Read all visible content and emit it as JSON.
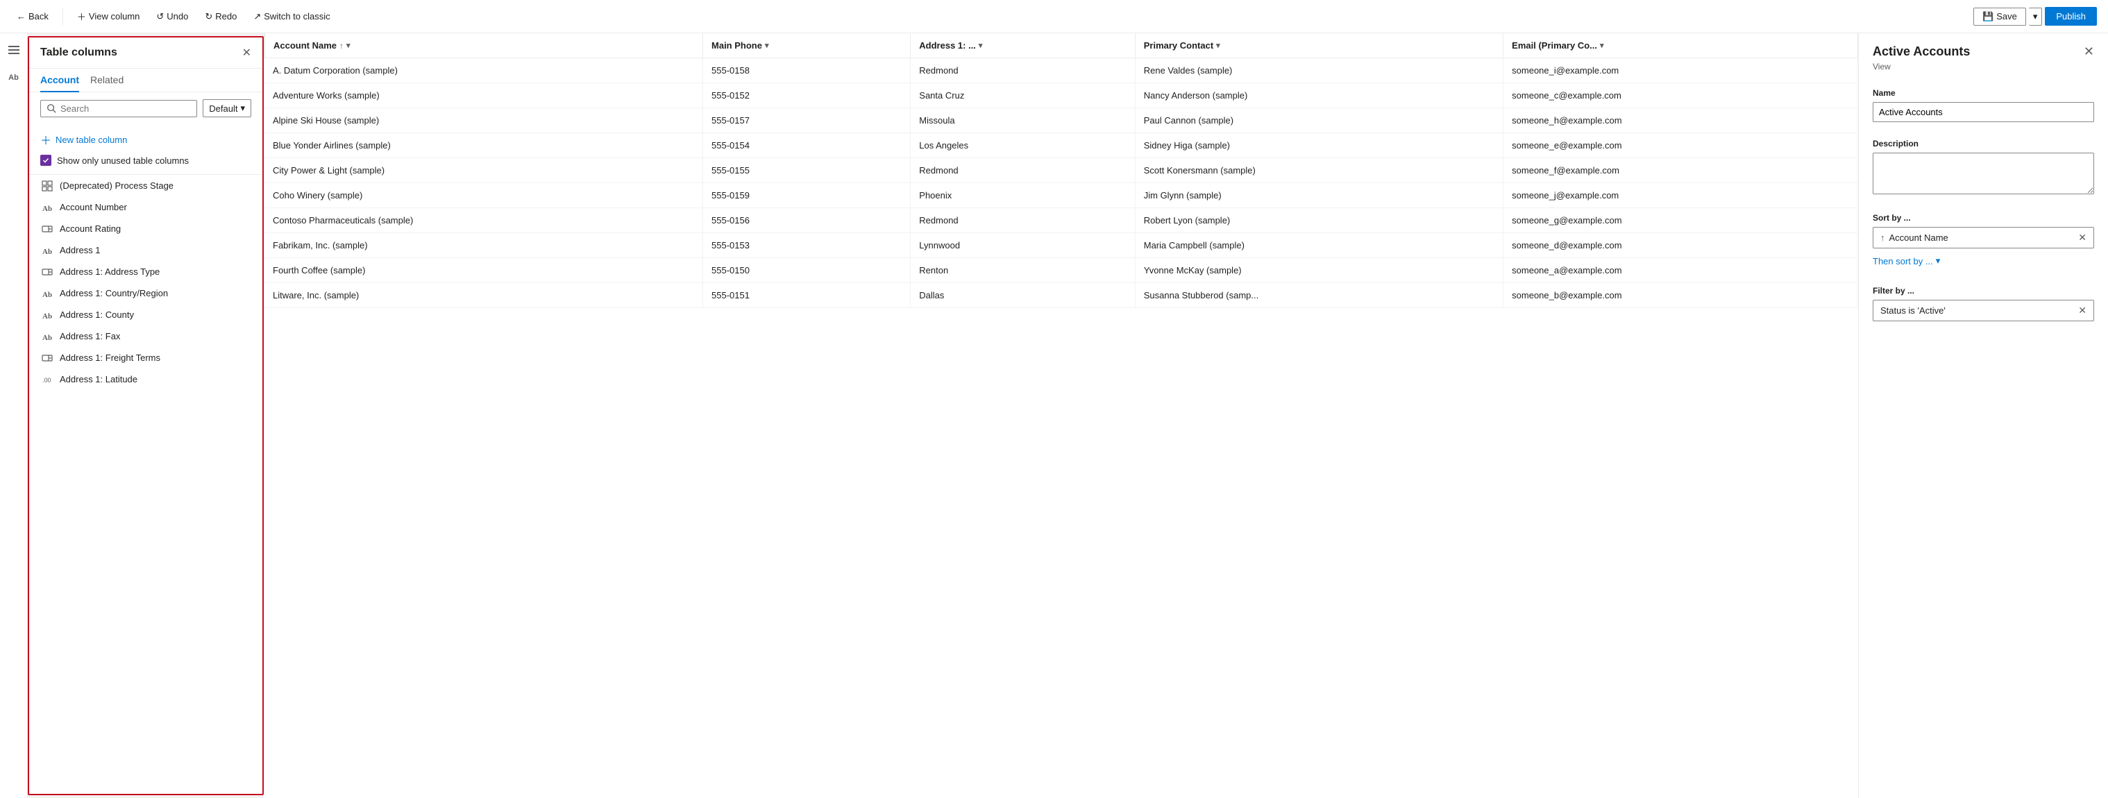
{
  "toolbar": {
    "back_label": "Back",
    "view_column_label": "View column",
    "undo_label": "Undo",
    "redo_label": "Redo",
    "switch_label": "Switch to classic",
    "save_label": "Save",
    "publish_label": "Publish"
  },
  "panel": {
    "title": "Table columns",
    "tab_account": "Account",
    "tab_related": "Related",
    "search_placeholder": "Search",
    "default_dropdown": "Default",
    "new_column_label": "New table column",
    "unused_label": "Show only unused table columns",
    "columns": [
      {
        "name": "(Deprecated) Process Stage",
        "type": "grid"
      },
      {
        "name": "Account Number",
        "type": "text"
      },
      {
        "name": "Account Rating",
        "type": "option"
      },
      {
        "name": "Address 1",
        "type": "text"
      },
      {
        "name": "Address 1: Address Type",
        "type": "option"
      },
      {
        "name": "Address 1: Country/Region",
        "type": "text"
      },
      {
        "name": "Address 1: County",
        "type": "text"
      },
      {
        "name": "Address 1: Fax",
        "type": "text"
      },
      {
        "name": "Address 1: Freight Terms",
        "type": "option"
      },
      {
        "name": "Address 1: Latitude",
        "type": "decimal"
      }
    ]
  },
  "grid": {
    "columns": [
      {
        "label": "Account Name",
        "sort": "asc",
        "filter": true
      },
      {
        "label": "Main Phone",
        "filter": true
      },
      {
        "label": "Address 1: ...",
        "filter": true
      },
      {
        "label": "Primary Contact",
        "filter": true
      },
      {
        "label": "Email (Primary Co...",
        "filter": true
      }
    ],
    "rows": [
      {
        "name": "A. Datum Corporation (sample)",
        "phone": "555-0158",
        "address": "Redmond",
        "contact": "Rene Valdes (sample)",
        "email": "someone_i@example.com"
      },
      {
        "name": "Adventure Works (sample)",
        "phone": "555-0152",
        "address": "Santa Cruz",
        "contact": "Nancy Anderson (sample)",
        "email": "someone_c@example.com"
      },
      {
        "name": "Alpine Ski House (sample)",
        "phone": "555-0157",
        "address": "Missoula",
        "contact": "Paul Cannon (sample)",
        "email": "someone_h@example.com"
      },
      {
        "name": "Blue Yonder Airlines (sample)",
        "phone": "555-0154",
        "address": "Los Angeles",
        "contact": "Sidney Higa (sample)",
        "email": "someone_e@example.com"
      },
      {
        "name": "City Power & Light (sample)",
        "phone": "555-0155",
        "address": "Redmond",
        "contact": "Scott Konersmann (sample)",
        "email": "someone_f@example.com"
      },
      {
        "name": "Coho Winery (sample)",
        "phone": "555-0159",
        "address": "Phoenix",
        "contact": "Jim Glynn (sample)",
        "email": "someone_j@example.com"
      },
      {
        "name": "Contoso Pharmaceuticals (sample)",
        "phone": "555-0156",
        "address": "Redmond",
        "contact": "Robert Lyon (sample)",
        "email": "someone_g@example.com"
      },
      {
        "name": "Fabrikam, Inc. (sample)",
        "phone": "555-0153",
        "address": "Lynnwood",
        "contact": "Maria Campbell (sample)",
        "email": "someone_d@example.com"
      },
      {
        "name": "Fourth Coffee (sample)",
        "phone": "555-0150",
        "address": "Renton",
        "contact": "Yvonne McKay (sample)",
        "email": "someone_a@example.com"
      },
      {
        "name": "Litware, Inc. (sample)",
        "phone": "555-0151",
        "address": "Dallas",
        "contact": "Susanna Stubberod (samp...",
        "email": "someone_b@example.com"
      }
    ]
  },
  "right_panel": {
    "title": "Active Accounts",
    "subtitle": "View",
    "name_label": "Name",
    "name_value": "Active Accounts",
    "description_label": "Description",
    "description_value": "",
    "sort_label": "Sort by ...",
    "sort_field": "Account Name",
    "then_sort_label": "Then sort by ...",
    "filter_label": "Filter by ...",
    "filter_value": "Status is 'Active'"
  }
}
